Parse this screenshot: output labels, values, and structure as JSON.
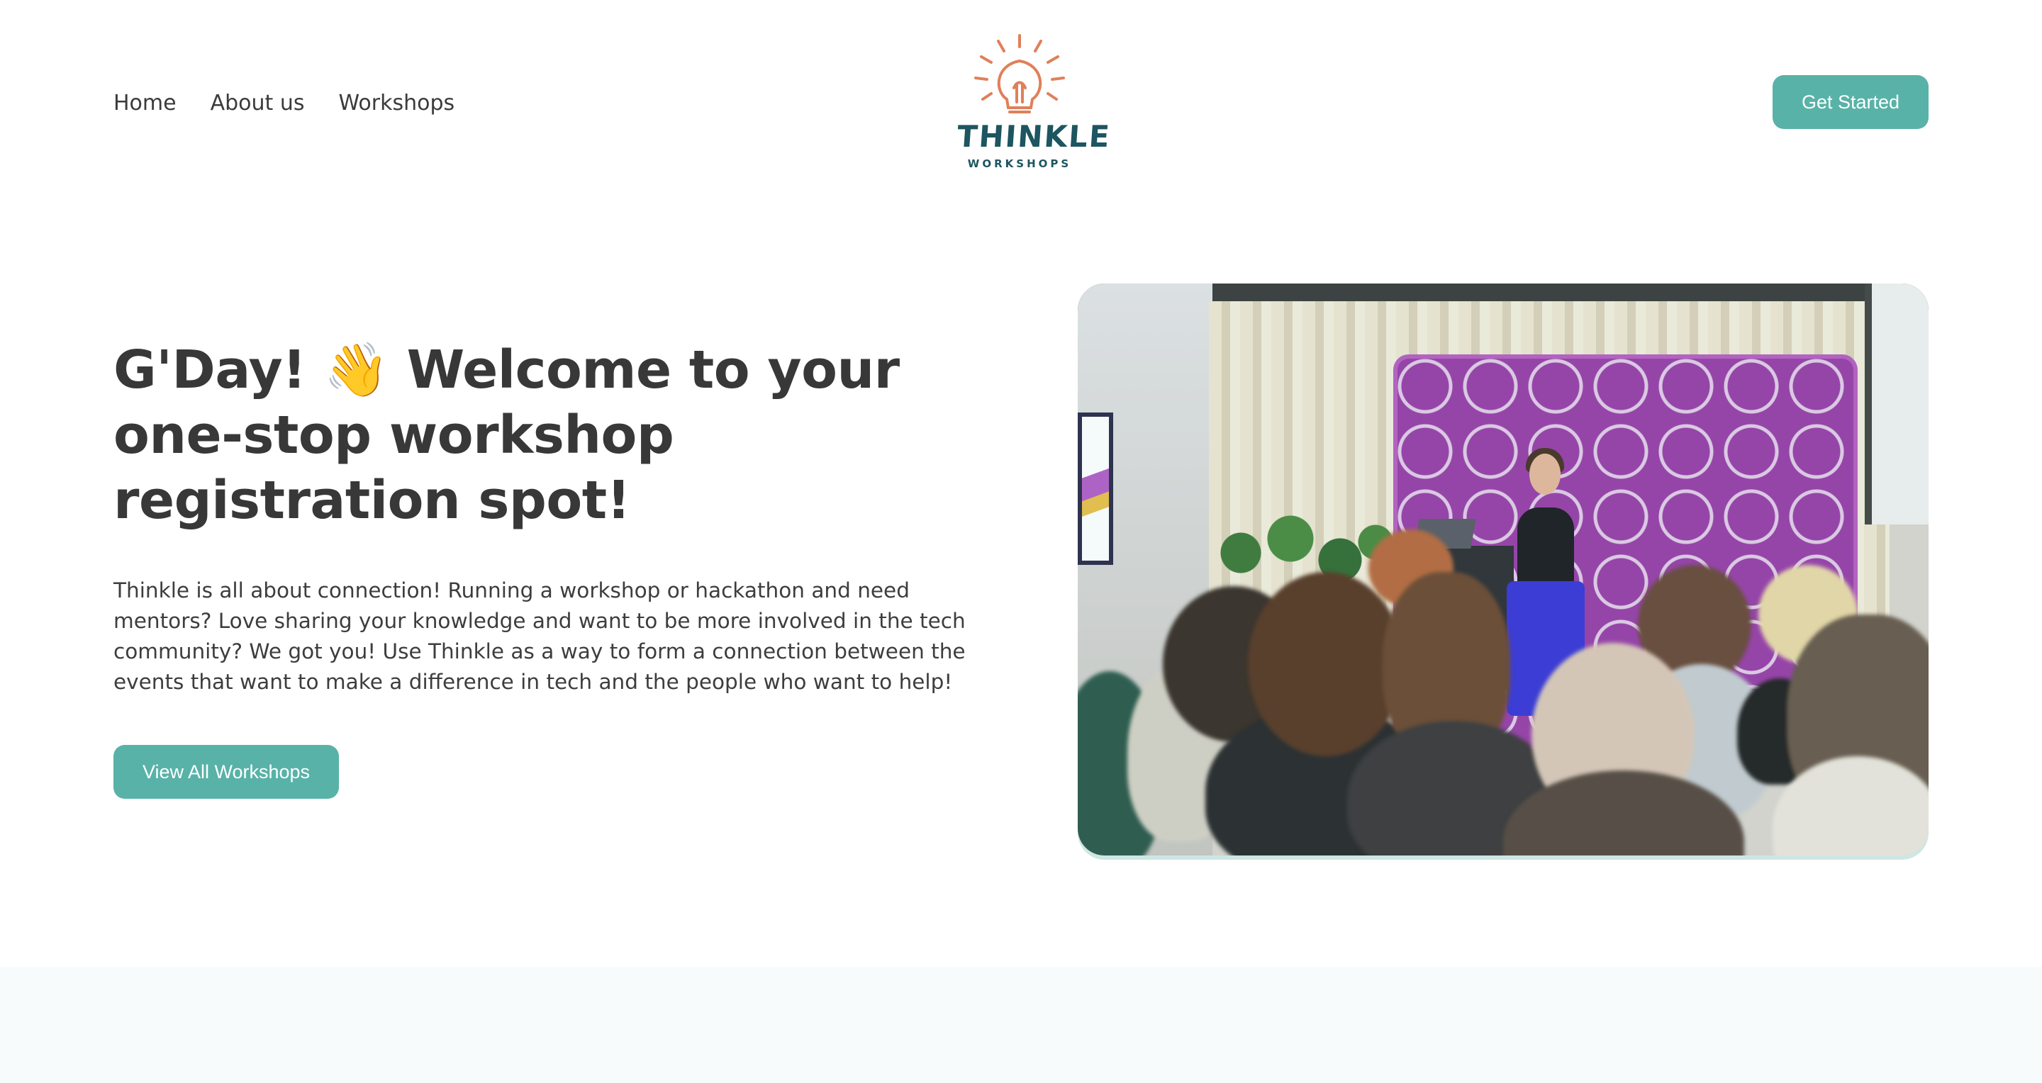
{
  "nav": {
    "items": [
      {
        "label": "Home"
      },
      {
        "label": "About us"
      },
      {
        "label": "Workshops"
      }
    ]
  },
  "logo": {
    "word": "THINKLE",
    "sub": "WORKSHOPS",
    "icon": "lightbulb-icon"
  },
  "header": {
    "cta_label": "Get Started"
  },
  "hero": {
    "title": "G'Day! 👋 Welcome to your one-stop workshop registration spot!",
    "body": "Thinkle is all about connection! Running a workshop or hackathon and need mentors? Love sharing your knowledge and want to be more involved in the tech community? We got you! Use Thinkle as a way to form a connection between the events that want to make a difference in tech and the people who want to help!",
    "button_label": "View All Workshops",
    "image": "workshop-photo"
  },
  "colors": {
    "accent": "#58b2a8",
    "logo_orange": "#e0805a",
    "logo_teal": "#1d5560",
    "text": "#3a3a3a",
    "band": "#f7fbfb"
  }
}
